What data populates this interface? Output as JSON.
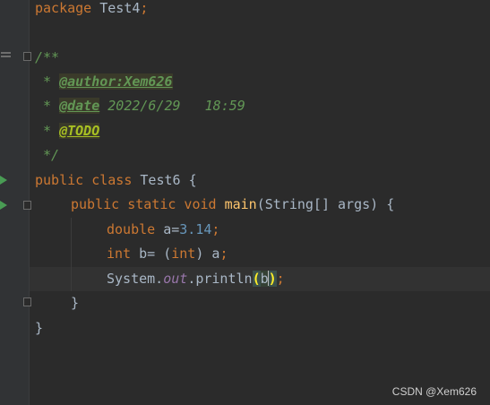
{
  "code": {
    "package_kw": "package",
    "package_name": " Test4",
    "semicolon": ";",
    "doc_open": "/**",
    "doc_star": " * ",
    "author_tag": "@author:Xem626",
    "date_tag": "@date",
    "date_value": " 2022/6/29   18:59",
    "todo_tag": "@TODO",
    "doc_close": " */",
    "kw_public": "public",
    "kw_class": " class",
    "class_name": " Test6 {",
    "kw_static": " static",
    "kw_void": " void",
    "method_name": " main",
    "params": "(String[] args) {",
    "kw_double": "double",
    "var_a": " a=",
    "value_a": "3.14",
    "kw_int": "int",
    "var_b": " b= (",
    "cast_kw": "int",
    "cast_rest": ") a",
    "system": "System.",
    "out": "out",
    "println": ".println",
    "paren_open": "(",
    "arg_b": "b",
    "paren_close": ")",
    "close_method": "}",
    "close_class": "}"
  },
  "watermark": "CSDN @Xem626",
  "colors": {
    "background": "#2b2b2b",
    "keyword": "#cc7832",
    "number": "#6897bb",
    "method": "#ffc66d",
    "doc_comment": "#629755",
    "run_gutter": "#499c54"
  }
}
